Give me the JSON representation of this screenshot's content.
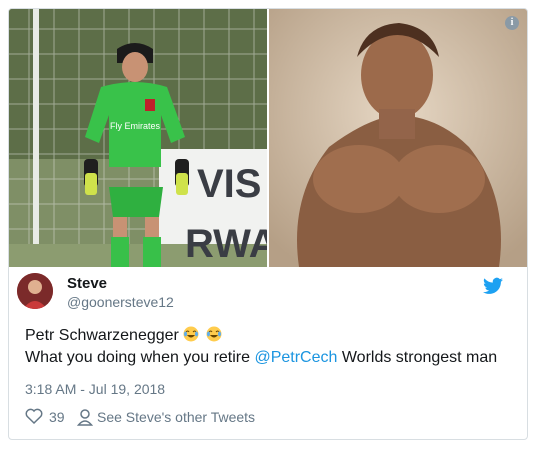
{
  "tweet": {
    "author_name": "Steve",
    "author_handle": "@goonersteve12",
    "text_line1": "Petr Schwarzenegger",
    "text_line2_prefix": "What you doing when you retire ",
    "mention": "@PetrCech",
    "text_line2_suffix": " Worlds strongest man",
    "timestamp": "3:18 AM - Jul 19, 2018",
    "like_count": "39",
    "other_tweets_link": "See Steve's other Tweets",
    "media_left_sign_top": "VIS",
    "media_left_sign_bottom": "RWAI",
    "jersey_text": "Fly Emirates",
    "info_icon_label": "i",
    "emoji_count": 2
  },
  "icons": {
    "platform": "twitter-bird-icon",
    "like": "heart-icon",
    "profile": "person-icon",
    "info": "info-icon",
    "emoji": "face-with-tears-of-joy-icon"
  },
  "colors": {
    "link": "#1b95e0",
    "secondary_text": "#657786",
    "primary_text": "#14171a",
    "border": "#d8dee2",
    "jersey": "#3ec94e"
  }
}
